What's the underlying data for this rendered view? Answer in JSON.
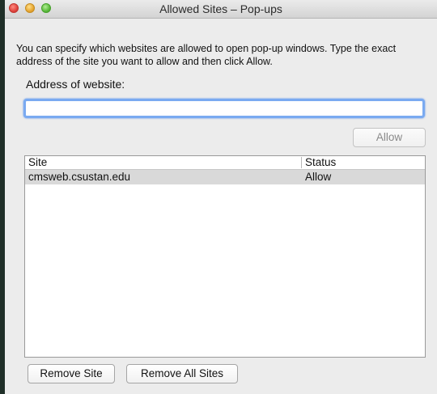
{
  "window": {
    "title": "Allowed Sites – Pop-ups"
  },
  "description": "You can specify which websites are allowed to open pop-up windows. Type the exact address of the site you want to allow and then click Allow.",
  "address": {
    "label": "Address of website:",
    "value": "",
    "placeholder": ""
  },
  "buttons": {
    "allow": "Allow",
    "remove_site": "Remove Site",
    "remove_all_sites": "Remove All Sites"
  },
  "table": {
    "columns": [
      "Site",
      "Status"
    ],
    "rows": [
      {
        "site": "cmsweb.csustan.edu",
        "status": "Allow"
      }
    ]
  }
}
